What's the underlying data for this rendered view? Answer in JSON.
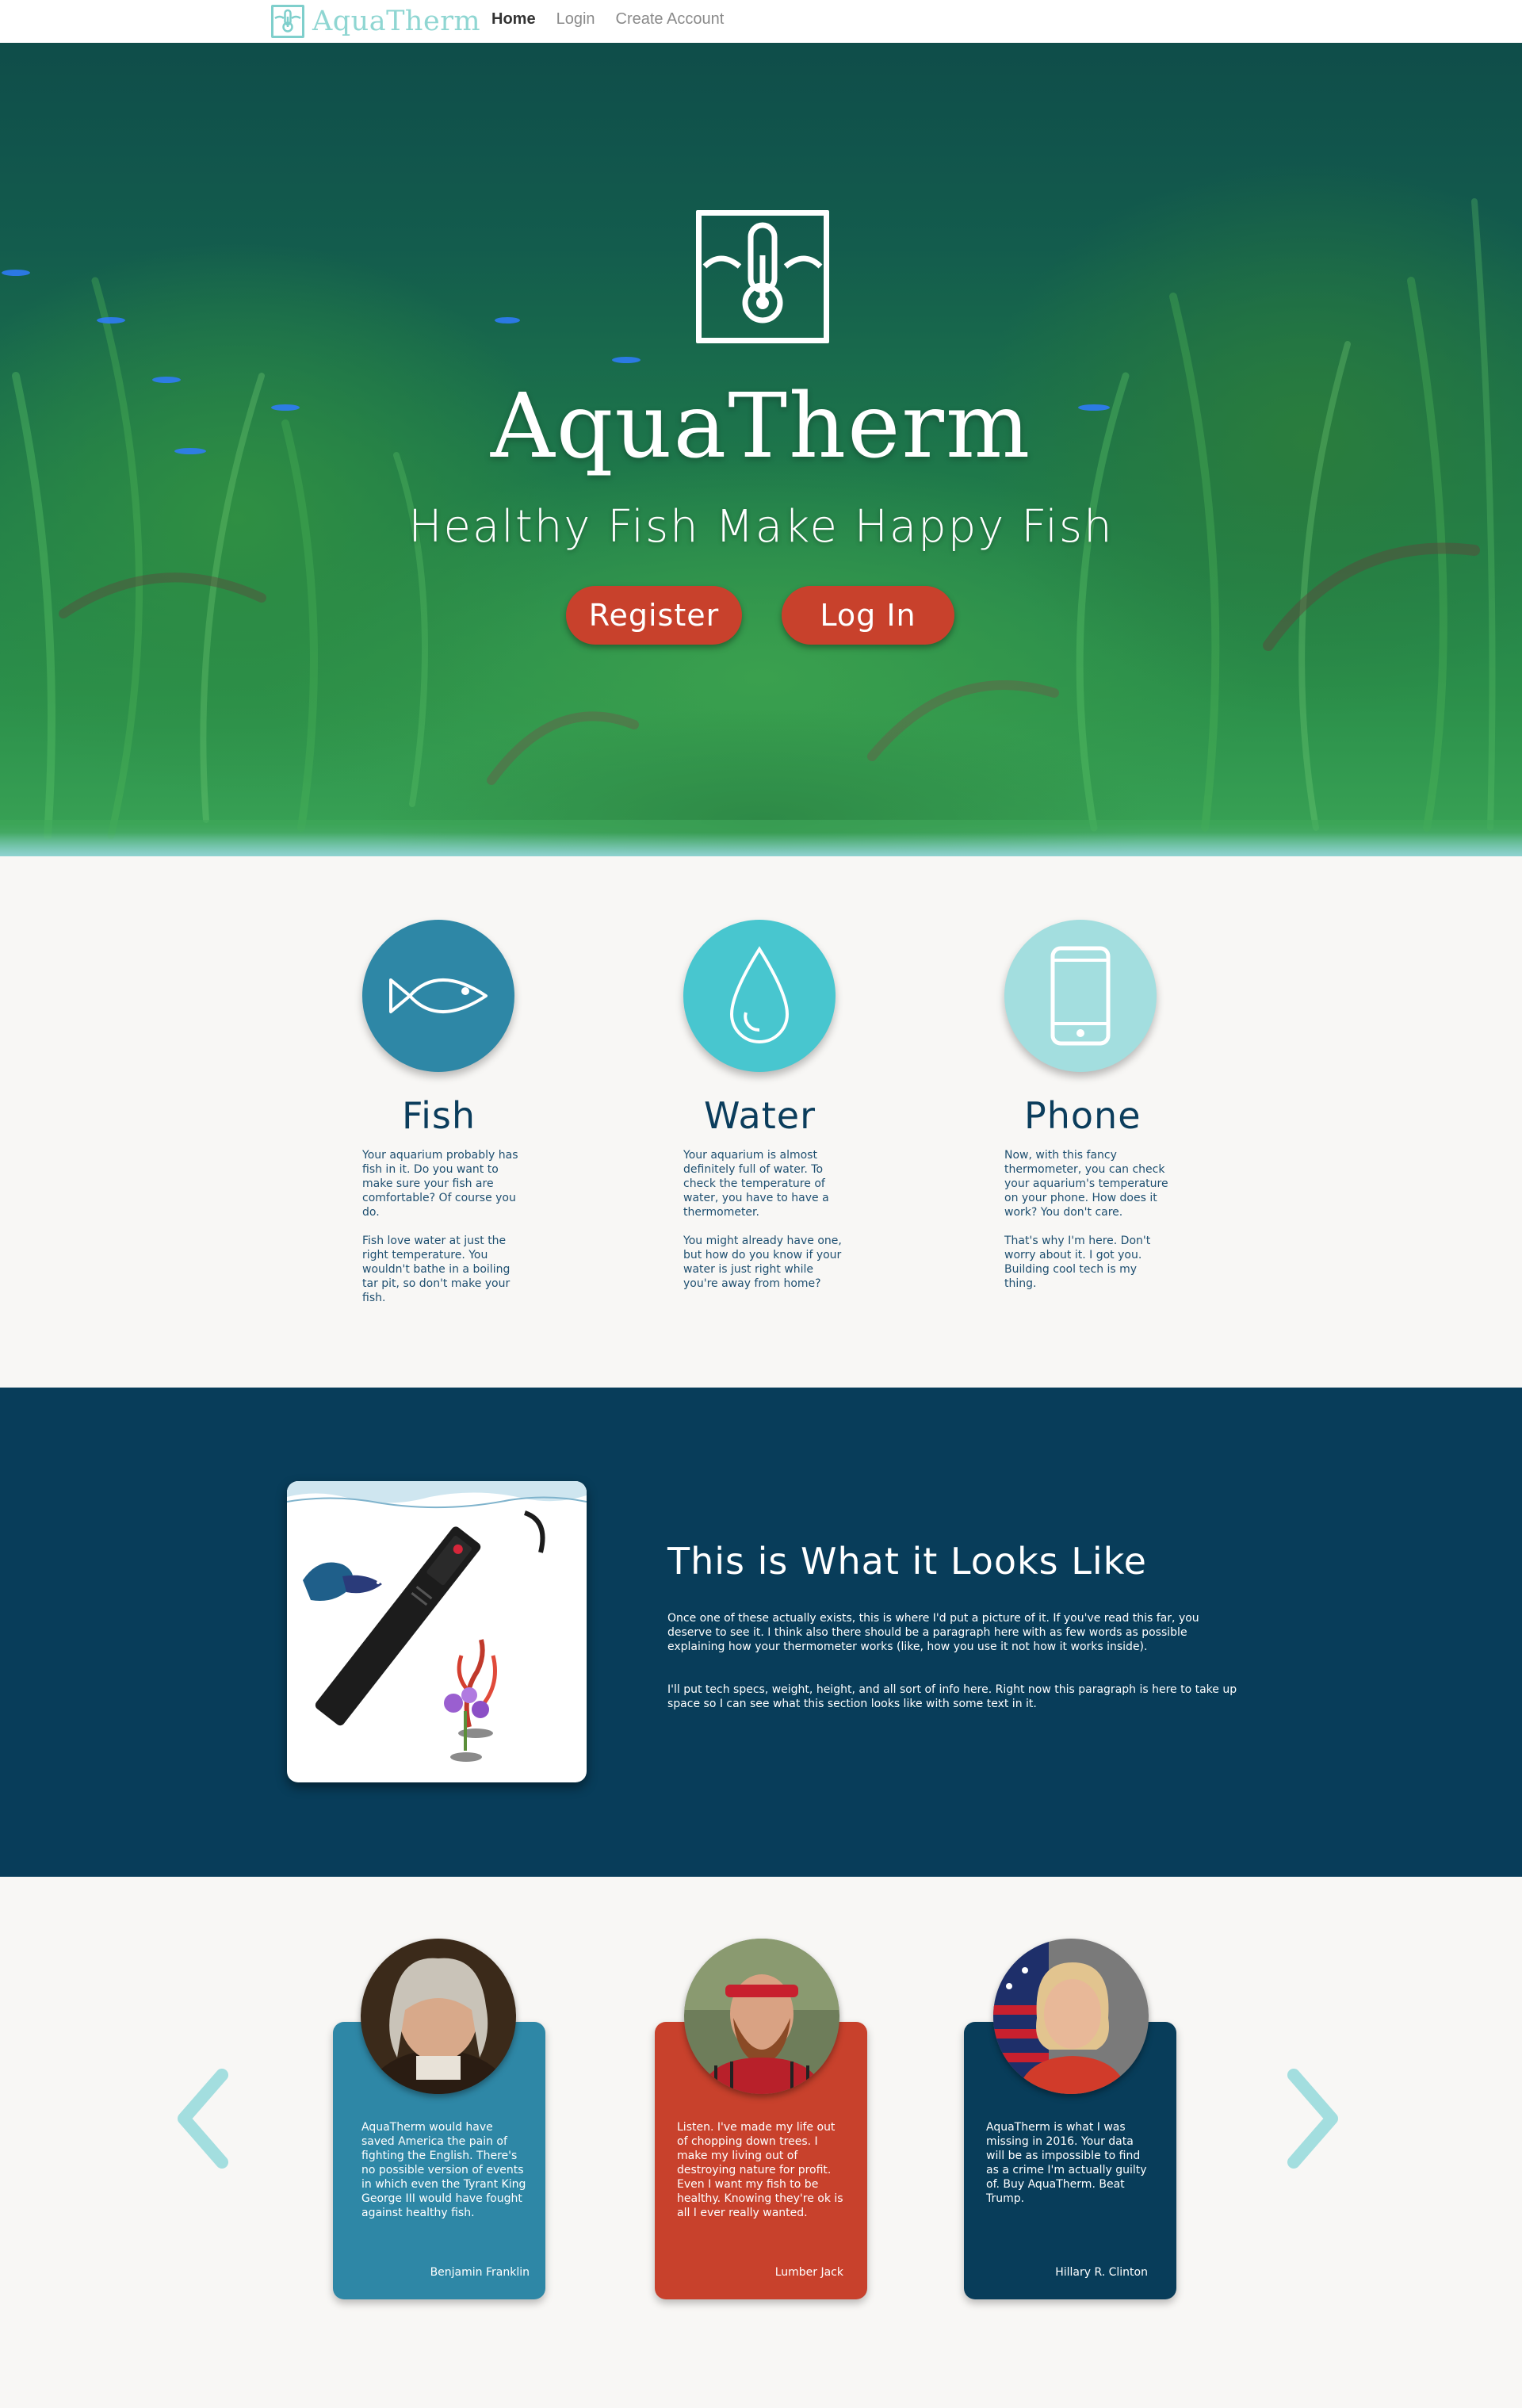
{
  "nav": {
    "brand": "AquaTherm",
    "links": [
      {
        "label": "Home",
        "active": true
      },
      {
        "label": "Login",
        "active": false
      },
      {
        "label": "Create Account",
        "active": false
      }
    ]
  },
  "hero": {
    "title": "AquaTherm",
    "subtitle": "Healthy Fish Make Happy Fish",
    "register_label": "Register",
    "login_label": "Log In"
  },
  "features": [
    {
      "icon": "fish-icon",
      "color": "#2e87a6",
      "title": "Fish",
      "text": "Your aquarium probably has fish in it. Do you want to make sure your fish are comfortable? Of course you do.\n\nFish love water at just the right temperature. You wouldn't bathe in a boiling tar pit, so don't make your fish."
    },
    {
      "icon": "water-drop-icon",
      "color": "#48c6cf",
      "title": "Water",
      "text": "Your aquarium is almost definitely full of water. To check the temperature of water, you have to have a thermometer.\n\nYou might already have one, but how do you know if your water is just right while you're away from home?"
    },
    {
      "icon": "phone-icon",
      "color": "#a3dedf",
      "title": "Phone",
      "text": "Now, with this fancy thermometer, you can check your aquarium's temperature on your phone. How does it work? You don't care.\n\nThat's why I'm here. Don't worry about it. I got you. Building cool tech is my thing."
    }
  ],
  "product": {
    "heading": "This is What it Looks Like",
    "paragraph1": "Once one of these actually exists, this is where I'd put a picture of it. If you've read this far, you deserve to see it. I think also there should be a paragraph here with as few words as possible explaining how your thermometer works (like, how you use it not how it works inside).",
    "paragraph2": "I'll put tech specs, weight, height, and all sort of info here. Right now this paragraph is here to take up space so I can see what this section looks like with some text in it."
  },
  "testimonials": [
    {
      "quote": "AquaTherm would have saved America the pain of fighting the English. There's no possible version of events in which even the Tyrant King George III would have fought against healthy fish.",
      "author": "Benjamin Franklin",
      "color": "#2e87a6"
    },
    {
      "quote": "Listen. I've made my life out of chopping down trees. I make my living out of destroying nature for profit. Even I want my fish to be healthy. Knowing they're ok is all I ever really wanted.",
      "author": "Lumber Jack",
      "color": "#c8412c"
    },
    {
      "quote": "AquaTherm is what I was missing in 2016. Your data will be as impossible to find as a crime I'm actually guilty of. Buy AquaTherm. Beat Trump.",
      "author": "Hillary R. Clinton",
      "color": "#083d5a"
    }
  ],
  "colors": {
    "accent_red": "#c8412c",
    "navy": "#083d5a",
    "teal": "#2e87a6",
    "aqua": "#48c6cf",
    "light_aqua": "#a3dedf"
  }
}
